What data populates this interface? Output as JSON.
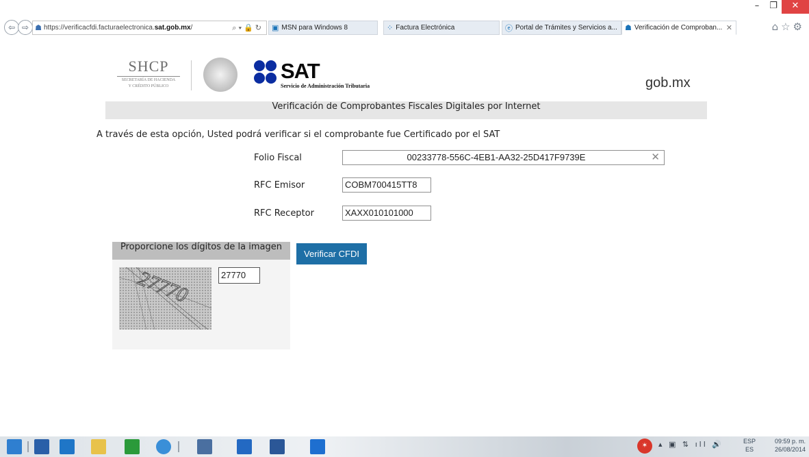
{
  "browser": {
    "url_prefix": "https://verificacfdi.facturaelectronica.",
    "url_domain": "sat.gob.mx",
    "url_suffix": "/",
    "tabs": [
      {
        "label": "MSN para Windows 8"
      },
      {
        "label": "Factura Electrónica"
      },
      {
        "label": "Portal de Trámites y Servicios a..."
      },
      {
        "label": "Verificación de Comproban..."
      }
    ],
    "toolbar_icons": [
      "home-icon",
      "favorites-icon",
      "settings-icon"
    ]
  },
  "header": {
    "shcp_title": "SHCP",
    "shcp_sub_line1": "SECRETARÍA DE HACIENDA",
    "shcp_sub_line2": "Y CRÉDITO PÚBLICO",
    "sat_title": "SAT",
    "sat_subtitle": "Servicio de Administración Tributaria",
    "gob_logo": "gob.mx",
    "page_title": "Verificación de Comprobantes Fiscales Digitales por Internet"
  },
  "form": {
    "intro": "A través de esta opción, Usted podrá verificar si el comprobante fue Certificado por el SAT",
    "folio_label": "Folio Fiscal",
    "folio_value": "00233778-556C-4EB1-AA32-25D417F9739E",
    "rfc_emisor_label": "RFC Emisor",
    "rfc_emisor_value": "COBM700415TT8",
    "rfc_receptor_label": "RFC Receptor",
    "rfc_receptor_value": "XAXX010101000"
  },
  "captcha": {
    "heading": "Proporcione los dígitos de la imagen",
    "image_text": "27770",
    "input_value": "27770",
    "verify_label": "Verificar CFDI"
  },
  "taskbar": {
    "items": [
      "start-icon",
      "desktop-app-icon",
      "file-explorer-icon",
      "store-icon",
      "internet-explorer-icon",
      "app-icon",
      "mail-icon",
      "word-icon",
      "ie-icon"
    ],
    "lang_line1": "ESP",
    "lang_line2": "ES",
    "time": "09:59 p. m.",
    "date": "26/08/2014"
  },
  "colors": {
    "sat_blue": "#0b2da1",
    "button_blue": "#1e6fa6",
    "title_bar_gray": "#e6e6e6",
    "captcha_head_gray": "#bdbdbd"
  }
}
